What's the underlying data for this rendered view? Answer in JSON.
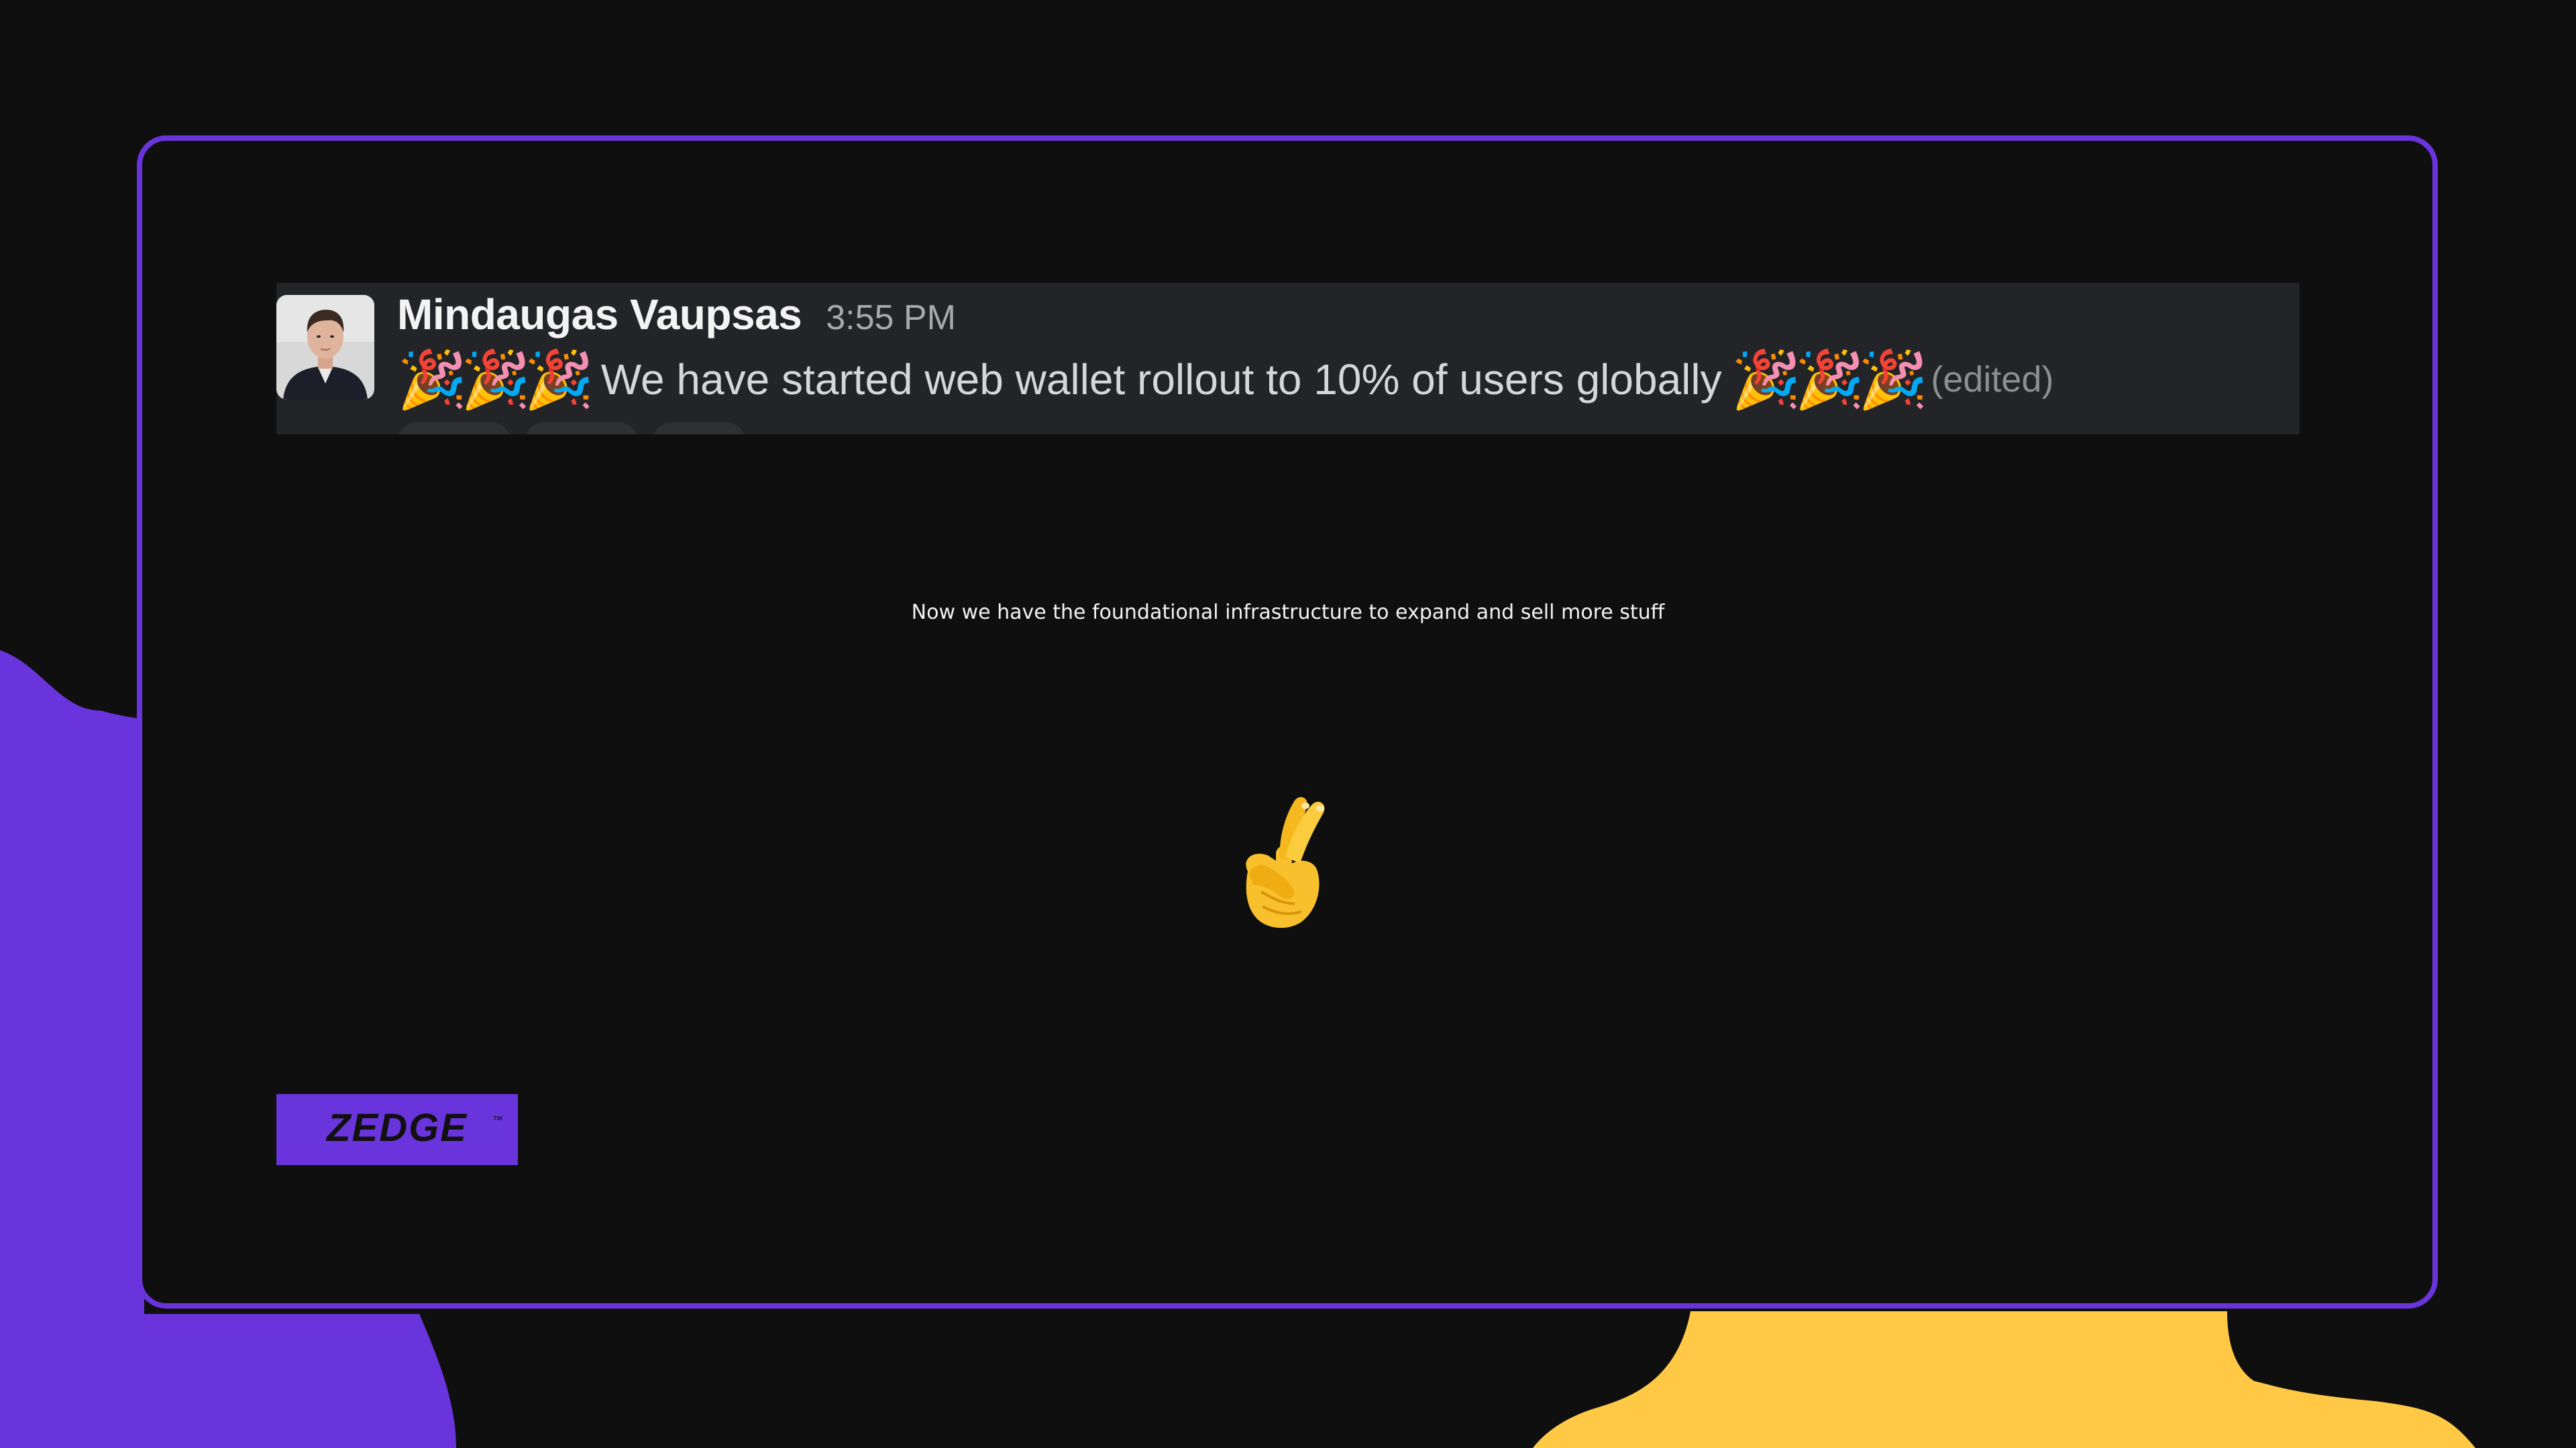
{
  "message": {
    "author": "Mindaugas Vaupsas",
    "timestamp": "3:55 PM",
    "emoji_prefix": "🎉🎉🎉",
    "text": "We have started web wallet rollout to 10% of users globally",
    "emoji_suffix": "🎉🎉🎉",
    "edited_label": "(edited)"
  },
  "caption": "Now we have the foundational infrastructure to expand and sell more stuff",
  "center_emoji": "crossed-fingers-icon",
  "logo": {
    "text": "ZEDGE",
    "trademark": "™"
  },
  "colors": {
    "background": "#0f0f0f",
    "brand_purple": "#6a34dc",
    "accent_yellow": "#ffc845",
    "message_bg": "#232427"
  }
}
